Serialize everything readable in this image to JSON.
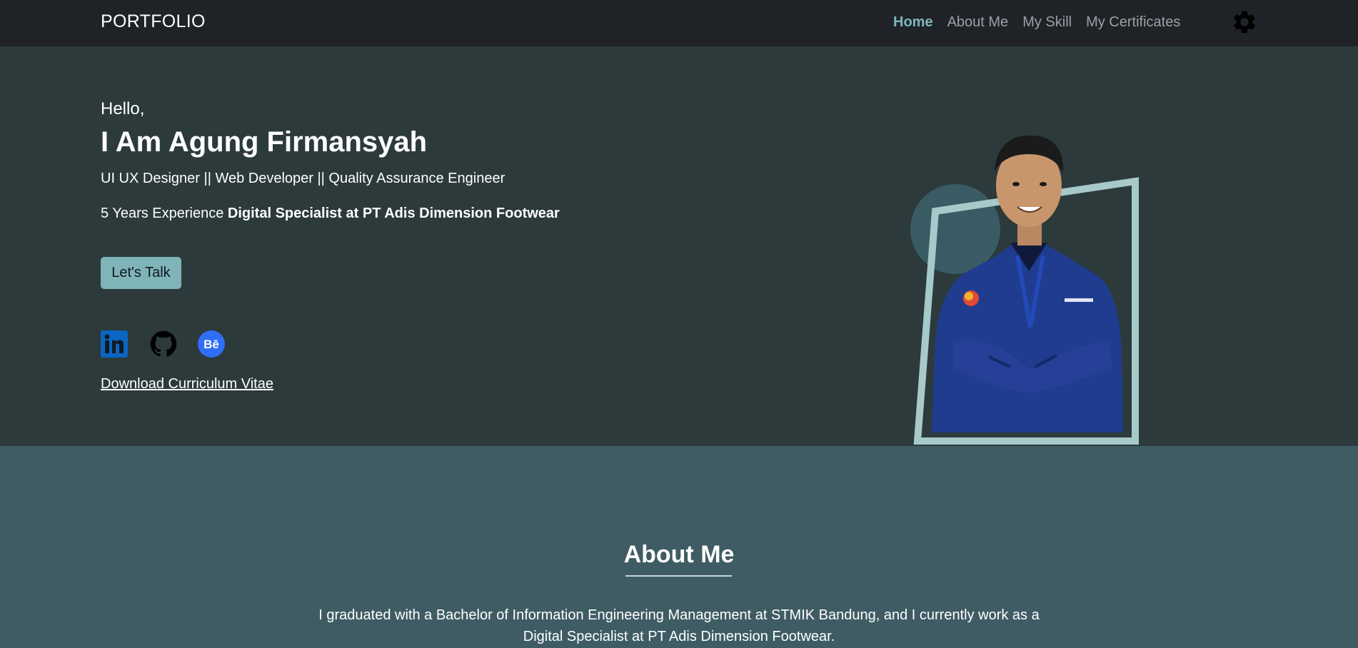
{
  "navbar": {
    "brand": "PORTFOLIO",
    "links": [
      {
        "label": "Home",
        "active": true
      },
      {
        "label": "About Me",
        "active": false
      },
      {
        "label": "My Skill",
        "active": false
      },
      {
        "label": "My Certificates",
        "active": false
      }
    ],
    "settings_icon": "gear-icon"
  },
  "hero": {
    "greeting": "Hello,",
    "name": "I Am Agung Firmansyah",
    "roles": "UI UX Designer || Web Developer || Quality Assurance Engineer",
    "experience_prefix": "5 Years Experience ",
    "experience_bold": "Digital Specialist at PT Adis Dimension Footwear",
    "cta_label": "Let's Talk",
    "socials": [
      {
        "icon": "linkedin-icon"
      },
      {
        "icon": "github-icon"
      },
      {
        "icon": "behance-icon"
      }
    ],
    "cv_link": "Download Curriculum Vitae"
  },
  "about": {
    "title": "About Me",
    "text": "I graduated with a Bachelor of Information Engineering Management at STMIK Bandung, and I currently work as a Digital Specialist at PT Adis Dimension Footwear."
  },
  "colors": {
    "navbar_bg": "#1f2327",
    "hero_bg": "#2c3a3c",
    "about_bg": "#3f5c64",
    "accent": "#7fb4b8",
    "active_link": "#7fb6bb"
  }
}
